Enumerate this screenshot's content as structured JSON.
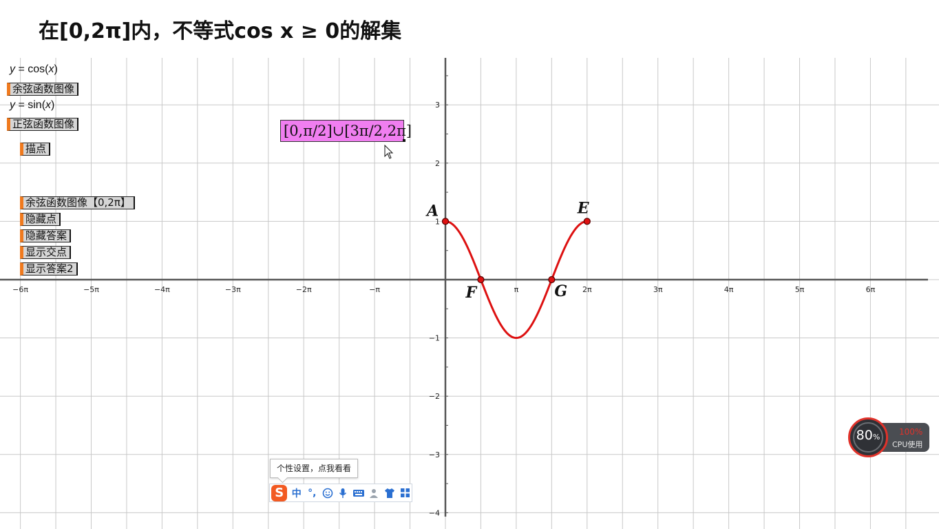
{
  "page": {
    "title": "在[0,2π]内，不等式cos x ≥ 0的解集"
  },
  "algebra": {
    "cos_eq": {
      "var": "y",
      "eq": " = cos(",
      "arg": "x",
      "close": ")"
    },
    "sin_eq": {
      "var": "y",
      "eq": " = sin(",
      "arg": "x",
      "close": ")"
    }
  },
  "buttons": {
    "cos_graph": "余弦函数图像",
    "sin_graph": "正弦函数图像",
    "plot_points": "描点",
    "cos_graph_interval": "余弦函数图像【0,2π】",
    "hide_points": "隐藏点",
    "hide_answer": "隐藏答案",
    "show_intersections": "显示交点",
    "show_answer2": "显示答案2"
  },
  "answer": {
    "text": "[0,π/2]∪[3π/2,2π]",
    "color": "#f07ef0"
  },
  "graph": {
    "x_ticks": [
      {
        "value": -6,
        "label": "−6π"
      },
      {
        "value": -5,
        "label": "−5π"
      },
      {
        "value": -4,
        "label": "−4π"
      },
      {
        "value": -3,
        "label": "−3π"
      },
      {
        "value": -2,
        "label": "−2π"
      },
      {
        "value": -1,
        "label": "−π"
      },
      {
        "value": 1,
        "label": "π"
      },
      {
        "value": 2,
        "label": "2π"
      },
      {
        "value": 3,
        "label": "3π"
      },
      {
        "value": 4,
        "label": "4π"
      },
      {
        "value": 5,
        "label": "5π"
      },
      {
        "value": 6,
        "label": "6π"
      }
    ],
    "y_ticks": [
      {
        "value": 3,
        "label": "3"
      },
      {
        "value": 2,
        "label": "2"
      },
      {
        "value": 1,
        "label": "1"
      },
      {
        "value": -1,
        "label": "−1"
      },
      {
        "value": -2,
        "label": "−2"
      },
      {
        "value": -3,
        "label": "−3"
      },
      {
        "value": -4,
        "label": "−4"
      }
    ],
    "curve_color": "#dd1111",
    "points": [
      {
        "name": "A",
        "x_pi": 0,
        "y": 1
      },
      {
        "name": "F",
        "x_pi": 0.5,
        "y": 0
      },
      {
        "name": "G",
        "x_pi": 1.5,
        "y": 0
      },
      {
        "name": "E",
        "x_pi": 2,
        "y": 1
      }
    ]
  },
  "ime": {
    "tooltip": "个性设置，点我看看",
    "logo": "S",
    "mode": "中",
    "punct": "°,",
    "icons": [
      "emoji-icon",
      "microphone-icon",
      "keyboard-icon",
      "user-icon",
      "skin-icon",
      "apps-icon"
    ]
  },
  "cpu": {
    "percent": "80",
    "unit": "%",
    "load": "100%",
    "caption": "CPU使用",
    "alert_color": "#e0322a"
  }
}
